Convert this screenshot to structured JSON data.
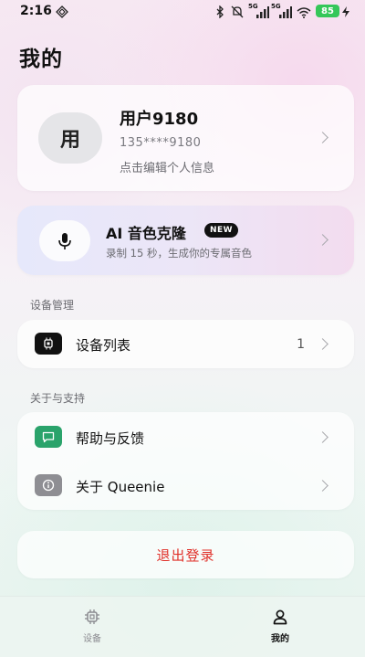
{
  "status_bar": {
    "time": "2:16",
    "battery": "85",
    "network_labels": [
      "5G",
      "5G"
    ]
  },
  "page_title": "我的",
  "profile": {
    "avatar_text": "用",
    "name": "用户9180",
    "phone": "135****9180",
    "edit_hint": "点击编辑个人信息"
  },
  "ai_clone": {
    "title": "AI 音色克隆",
    "badge": "NEW",
    "subtitle": "录制 15 秒，生成你的专属音色"
  },
  "device_section": {
    "label": "设备管理",
    "items": [
      {
        "label": "设备列表",
        "count": "1",
        "icon": "chip-icon"
      }
    ]
  },
  "about_section": {
    "label": "关于与支持",
    "items": [
      {
        "label": "帮助与反馈",
        "icon": "chat-bubble-icon"
      },
      {
        "label": "关于 Queenie",
        "icon": "info-icon"
      }
    ]
  },
  "logout_label": "退出登录",
  "bottom_nav": {
    "items": [
      {
        "label": "设备",
        "icon": "chip-icon",
        "active": false
      },
      {
        "label": "我的",
        "icon": "person-icon",
        "active": true
      }
    ]
  },
  "colors": {
    "logout_red": "#e0312a",
    "help_green": "#2aa36b",
    "info_gray": "#8e8e93",
    "badge_black": "#111111",
    "battery_green": "#35c759"
  }
}
